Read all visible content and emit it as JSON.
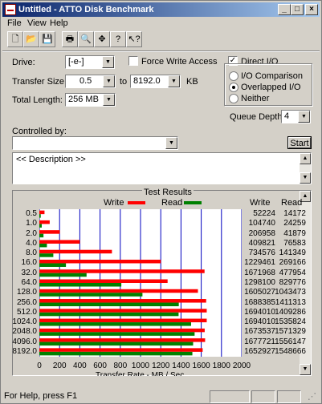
{
  "window": {
    "title": "Untitled - ATTO Disk Benchmark",
    "controls": [
      "_",
      "□",
      "×"
    ]
  },
  "menu": [
    "File",
    "View",
    "Help"
  ],
  "toolbar": [
    {
      "name": "new-icon",
      "glyph": "🗋"
    },
    {
      "name": "open-icon",
      "glyph": "📂"
    },
    {
      "name": "save-icon",
      "glyph": "💾"
    },
    {
      "name": "print-icon",
      "glyph": "🖶"
    },
    {
      "name": "print-preview-icon",
      "glyph": "🔍"
    },
    {
      "name": "move-icon",
      "glyph": "✥"
    },
    {
      "name": "help-icon",
      "glyph": "?"
    },
    {
      "name": "context-help-icon",
      "glyph": "↖?"
    }
  ],
  "form": {
    "drive_label": "Drive:",
    "drive_value": "[-e-]",
    "force_write_label": "Force Write Access",
    "direct_io_label": "Direct I/O",
    "direct_io_checked": true,
    "transfer_size_label": "Transfer Size:",
    "transfer_from": "0.5",
    "to_label": "to",
    "transfer_to": "8192.0",
    "kb_label": "KB",
    "total_length_label": "Total Length:",
    "total_length_value": "256 MB",
    "io_comparison_label": "I/O Comparison",
    "overlapped_io_label": "Overlapped I/O",
    "neither_label": "Neither",
    "queue_depth_label": "Queue Depth:",
    "queue_depth_value": "4",
    "controlled_by_label": "Controlled by:",
    "controlled_by_value": "",
    "start_label": "Start",
    "description_text": "<< Description >>"
  },
  "results": {
    "title": "Test Results",
    "write_legend": "Write",
    "read_legend": "Read",
    "write_col": "Write",
    "read_col": "Read",
    "axis_title": "Transfer Rate - MB / Sec"
  },
  "colors": {
    "write": "#ff0000",
    "read": "#008000",
    "grid": "#0000c0",
    "title_start": "#0a246a"
  },
  "chart_data": {
    "type": "bar",
    "orientation": "horizontal",
    "categories": [
      "0.5",
      "1.0",
      "2.0",
      "4.0",
      "8.0",
      "16.0",
      "32.0",
      "64.0",
      "128.0",
      "256.0",
      "512.0",
      "1024.0",
      "2048.0",
      "4096.0",
      "8192.0"
    ],
    "series": [
      {
        "name": "Write",
        "values": [
          52224,
          104740,
          206958,
          409821,
          734576,
          1229461,
          1671968,
          1298100,
          1605027,
          1688385,
          1694010,
          1694010,
          1673537,
          1677721,
          1652927
        ]
      },
      {
        "name": "Read",
        "values": [
          14172,
          24259,
          41879,
          76583,
          141349,
          269166,
          477954,
          829776,
          1043473,
          1411313,
          1409286,
          1535824,
          1571329,
          1556147,
          1548666
        ]
      }
    ],
    "xticks": [
      "0",
      "200",
      "400",
      "600",
      "800",
      "1000",
      "1200",
      "1400",
      "1600",
      "1800",
      "2000"
    ],
    "xlim": [
      0,
      2000
    ],
    "xlabel": "Transfer Rate - MB / Sec"
  },
  "status": {
    "text": "For Help, press F1"
  }
}
